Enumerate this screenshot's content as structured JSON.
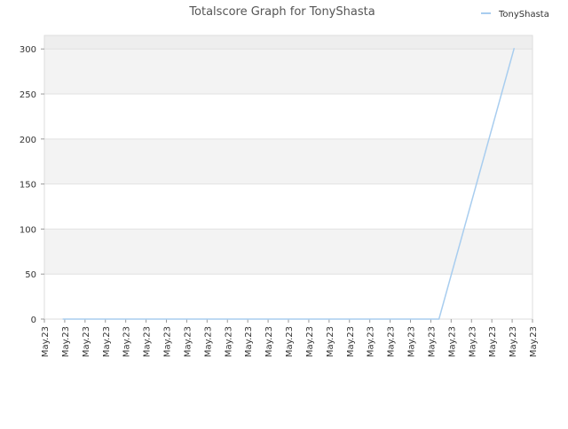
{
  "chart_data": {
    "type": "line",
    "title": "Totalscore Graph for TonyShasta",
    "xlabel": "",
    "ylabel": "",
    "x_tick_labels": [
      "May.23",
      "May.23",
      "May.23",
      "May.23",
      "May.23",
      "May.23",
      "May.23",
      "May.23",
      "May.23",
      "May.23",
      "May.23",
      "May.23",
      "May.23",
      "May.23",
      "May.23",
      "May.23",
      "May.23",
      "May.23",
      "May.23",
      "May.23",
      "May.23",
      "May.23",
      "May.23",
      "May.23",
      "May.23"
    ],
    "yticks": [
      0,
      50,
      100,
      150,
      200,
      250,
      300
    ],
    "ylim": [
      0,
      315
    ],
    "xlim": [
      0,
      24
    ],
    "grid": true,
    "legend_position": "top-right",
    "series": [
      {
        "name": "TonyShasta",
        "color": "#a8cdef",
        "x": [
          0.9,
          19.4,
          23.1
        ],
        "y": [
          0,
          0,
          301
        ]
      }
    ]
  }
}
